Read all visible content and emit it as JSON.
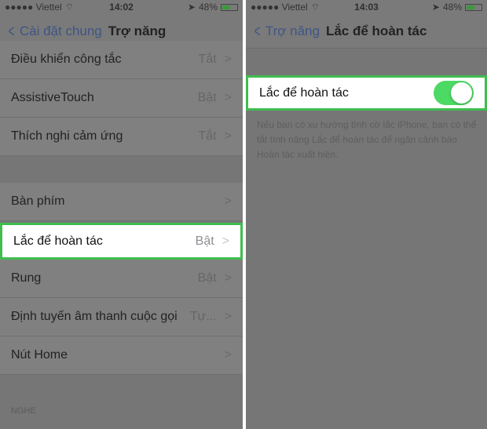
{
  "left": {
    "status": {
      "carrier": "●●●●● Viettel",
      "time": "14:02",
      "battery": "48%"
    },
    "nav": {
      "back": "Cài đặt chung",
      "title": "Trợ năng"
    },
    "rows": [
      {
        "label": "Điều khiển công tắc",
        "value": "Tắt"
      },
      {
        "label": "AssistiveTouch",
        "value": "Bật"
      },
      {
        "label": "Thích nghi cảm ứng",
        "value": "Tắt"
      },
      {
        "label": "Bàn phím",
        "value": ""
      },
      {
        "label": "Lắc để hoàn tác",
        "value": "Bật"
      },
      {
        "label": "Rung",
        "value": "Bật"
      },
      {
        "label": "Định tuyến âm thanh cuộc gọi",
        "value": "Tự..."
      },
      {
        "label": "Nút Home",
        "value": ""
      }
    ],
    "section": "NGHE"
  },
  "right": {
    "status": {
      "carrier": "●●●●● Viettel",
      "time": "14:03",
      "battery": "48%"
    },
    "nav": {
      "back": "Trợ năng",
      "title": "Lắc để hoàn tác"
    },
    "toggle_label": "Lắc để hoàn tác",
    "toggle_on": true,
    "footer": "Nếu bạn có xu hướng tình cờ lắc iPhone, bạn có thể tắt tính năng Lắc để hoàn tác để ngăn cảnh báo Hoàn tác xuất hiện."
  },
  "colors": {
    "highlight": "#3fbd4f",
    "toggle": "#4cd964",
    "link": "#007aff"
  }
}
